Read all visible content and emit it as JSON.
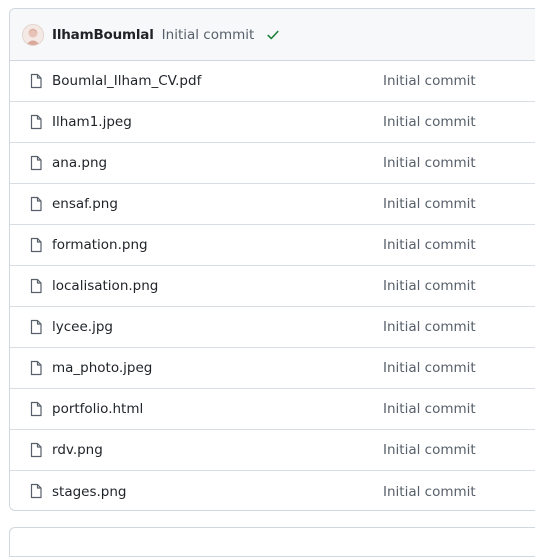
{
  "latest_commit": {
    "author": "IlhamBoumlal",
    "message": "Initial commit",
    "status_icon": "check-icon",
    "status_color": "#1a7f37"
  },
  "files": [
    {
      "name": "Boumlal_Ilham_CV.pdf",
      "message": "Initial commit"
    },
    {
      "name": "Ilham1.jpeg",
      "message": "Initial commit"
    },
    {
      "name": "ana.png",
      "message": "Initial commit"
    },
    {
      "name": "ensaf.png",
      "message": "Initial commit"
    },
    {
      "name": "formation.png",
      "message": "Initial commit"
    },
    {
      "name": "localisation.png",
      "message": "Initial commit"
    },
    {
      "name": "lycee.jpg",
      "message": "Initial commit"
    },
    {
      "name": "ma_photo.jpeg",
      "message": "Initial commit"
    },
    {
      "name": "portfolio.html",
      "message": "Initial commit"
    },
    {
      "name": "rdv.png",
      "message": "Initial commit"
    },
    {
      "name": "stages.png",
      "message": "Initial commit"
    }
  ]
}
